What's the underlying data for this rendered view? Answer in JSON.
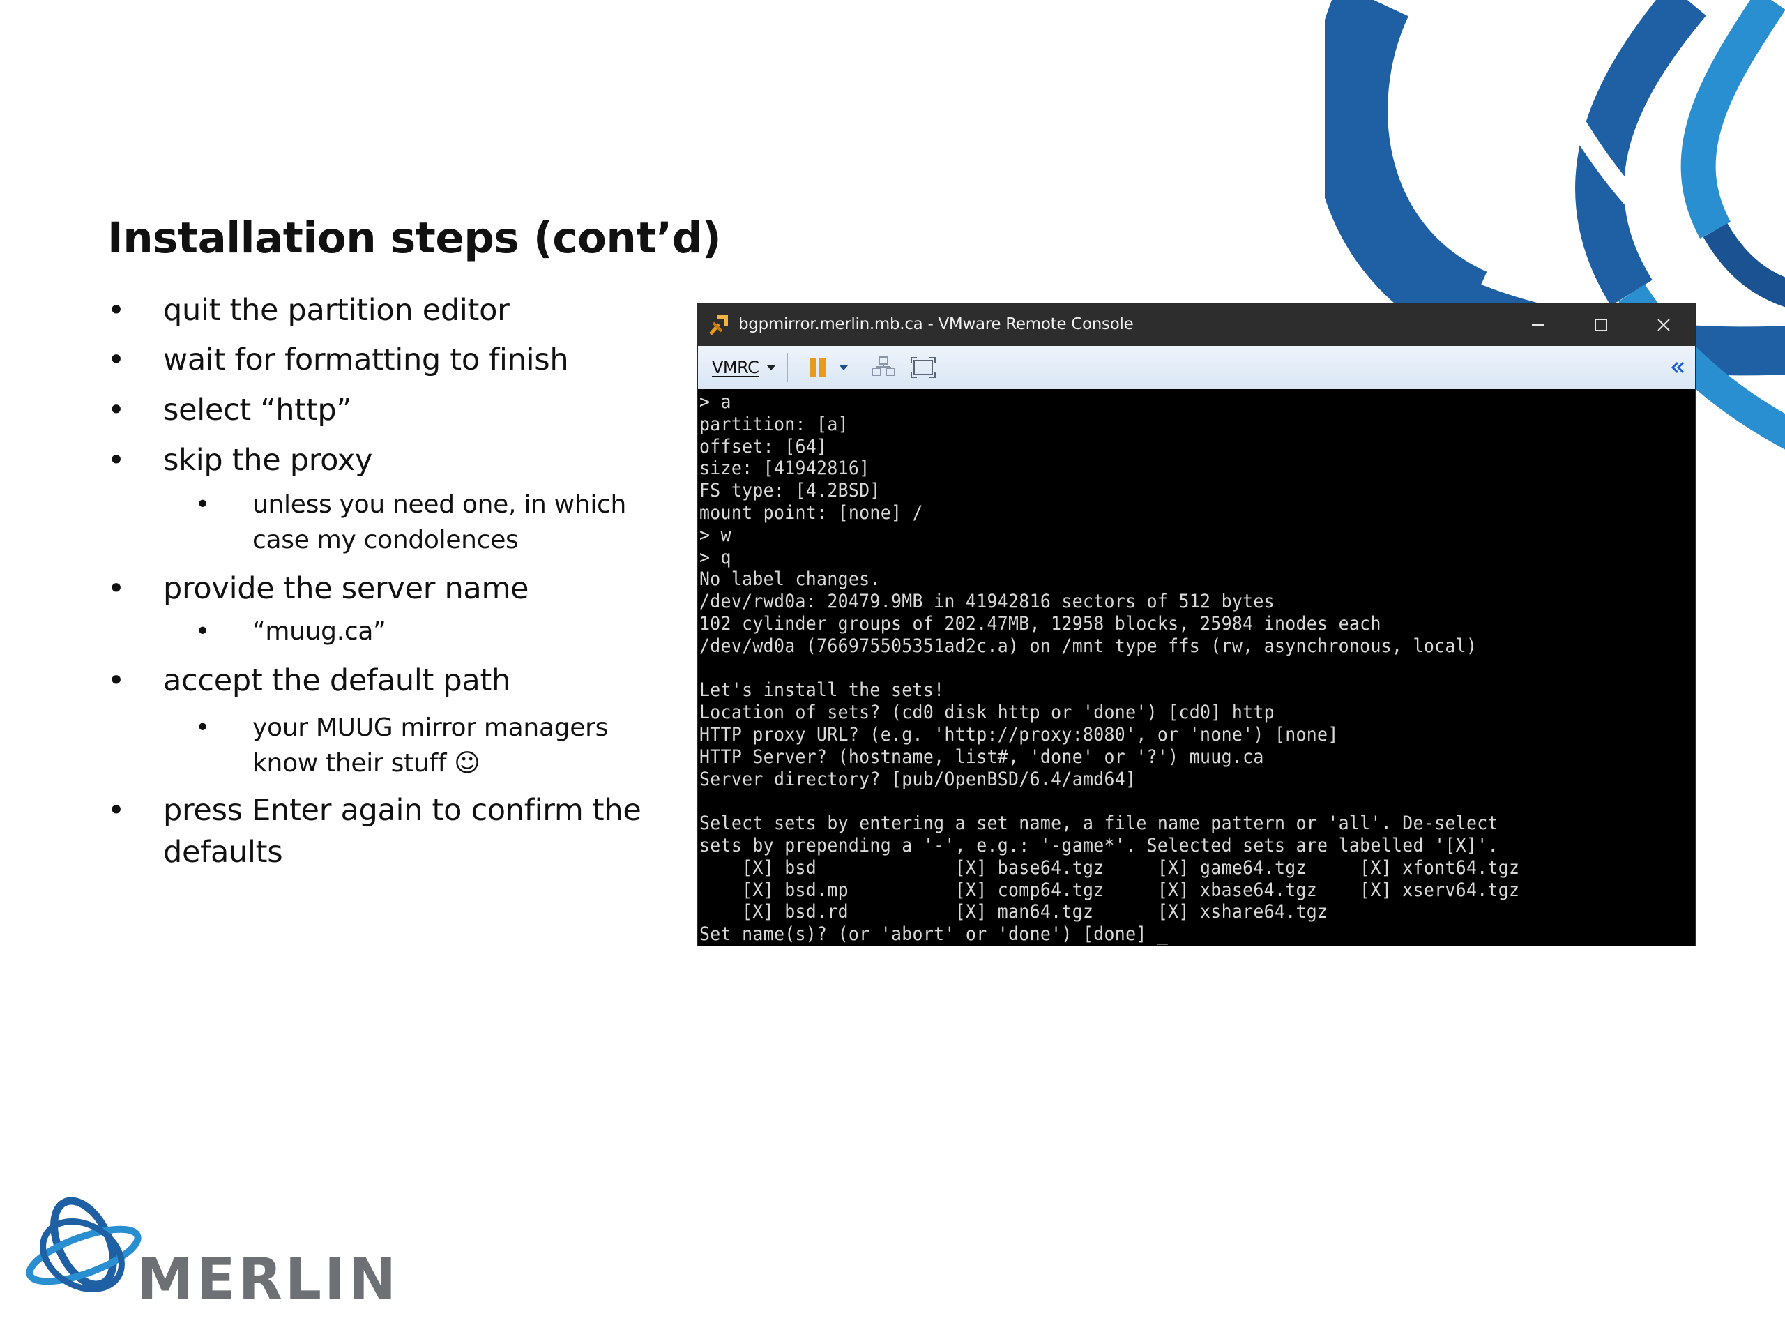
{
  "slide": {
    "title": "Installation steps (cont’d)",
    "bullet_glyph": "•",
    "bullets": [
      {
        "text": "quit the partition editor"
      },
      {
        "text": "wait for formatting to finish"
      },
      {
        "text": "select “http”"
      },
      {
        "text": "skip the proxy"
      },
      {
        "text": "unless you need one, in which",
        "sub": true
      },
      {
        "text": "case my condolences",
        "sub": true,
        "continuation": true
      },
      {
        "text": "provide the server name"
      },
      {
        "text": "“muug.ca”",
        "sub": true
      },
      {
        "text": "accept the default path"
      },
      {
        "text": "your MUUG mirror managers",
        "sub": true
      },
      {
        "text": "know their stuff ☺",
        "sub": true,
        "continuation": true
      },
      {
        "text": "press Enter again to confirm the"
      },
      {
        "text": "defaults",
        "continuation": true
      }
    ]
  },
  "window": {
    "title": "bgpmirror.merlin.mb.ca - VMware Remote Console",
    "app_icon": "vmrc-icon",
    "minimize_icon": "minimize-icon",
    "maximize_icon": "maximize-icon",
    "close_icon": "close-icon"
  },
  "toolbar": {
    "menu_label": "VMRC",
    "menu_icon": "chevron-down-icon",
    "pause_icon": "pause-icon",
    "send_keys_icon": "network-icon",
    "fullscreen_icon": "fullscreen-icon",
    "collapse_icon": "double-chevron-left-icon"
  },
  "terminal": {
    "lines": [
      "> a",
      "partition: [a]",
      "offset: [64]",
      "size: [41942816]",
      "FS type: [4.2BSD]",
      "mount point: [none] /",
      "> w",
      "> q",
      "No label changes.",
      "/dev/rwd0a: 20479.9MB in 41942816 sectors of 512 bytes",
      "102 cylinder groups of 202.47MB, 12958 blocks, 25984 inodes each",
      "/dev/wd0a (766975505351ad2c.a) on /mnt type ffs (rw, asynchronous, local)",
      "",
      "Let's install the sets!",
      "Location of sets? (cd0 disk http or 'done') [cd0] http",
      "HTTP proxy URL? (e.g. 'http://proxy:8080', or 'none') [none]",
      "HTTP Server? (hostname, list#, 'done' or '?') muug.ca",
      "Server directory? [pub/OpenBSD/6.4/amd64]",
      "",
      "Select sets by entering a set name, a file name pattern or 'all'. De-select",
      "sets by prepending a '-', e.g.: '-game*'. Selected sets are labelled '[X]'.",
      "    [X] bsd             [X] base64.tgz     [X] game64.tgz     [X] xfont64.tgz",
      "    [X] bsd.mp          [X] comp64.tgz     [X] xbase64.tgz    [X] xserv64.tgz",
      "    [X] bsd.rd          [X] man64.tgz      [X] xshare64.tgz",
      "Set name(s)? (or 'abort' or 'done') [done] _"
    ]
  },
  "footer": {
    "logo_text": "MERLIN",
    "logo_icon": "merlin-swirl-icon"
  },
  "colors": {
    "brand_blue": "#1f5fa3",
    "brand_light_blue": "#2a8fd0",
    "brand_gray": "#6d7074",
    "titlebar": "#2d2d2d",
    "terminal_bg": "#000000",
    "terminal_fg": "#d9d9d9",
    "pause_orange": "#e89a1c"
  }
}
